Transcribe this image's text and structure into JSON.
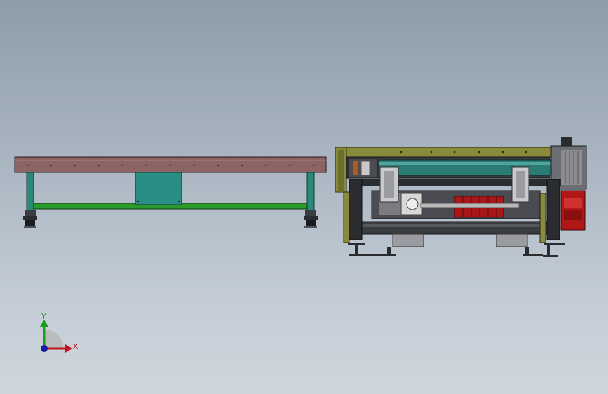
{
  "triad": {
    "x_label": "X",
    "y_label": "Y",
    "x_color": "#c0141c",
    "y_color": "#18a018",
    "z_color": "#1a1aa8"
  },
  "colors": {
    "table_top": "#8c6464",
    "table_leg": "#2a8a7a",
    "crossbar": "#2c9a2a",
    "panel": "#2a8e84",
    "frame_olive": "#8a8a3c",
    "frame_dark": "#3a3c40",
    "roller_teal": "#2b7a74",
    "motor_red": "#b01818"
  }
}
